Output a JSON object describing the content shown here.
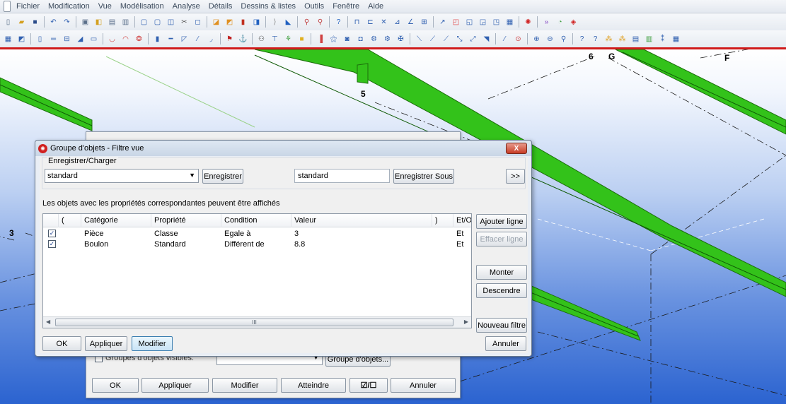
{
  "menubar": [
    "Fichier",
    "Modification",
    "Vue",
    "Modélisation",
    "Analyse",
    "Détails",
    "Dessins & listes",
    "Outils",
    "Fenêtre",
    "Aide"
  ],
  "viewport_labels": {
    "l5": "5",
    "l6": "6",
    "lG": "G",
    "lF": "F",
    "l3": "3"
  },
  "back_dialog": {
    "checkbox_label": "Groupes d'objets visibles:",
    "group_button": "Groupe d'objets...",
    "ok": "OK",
    "apply": "Appliquer",
    "modify": "Modifier",
    "reach": "Atteindre",
    "toggle": "☑/☐",
    "cancel": "Annuler"
  },
  "dialog": {
    "title": "Groupe d'objets - Filtre vue",
    "close": "X",
    "group_label": "Enregistrer/Charger",
    "load_value": "standard",
    "save_button": "Enregistrer",
    "saveas_value": "standard",
    "saveas_button": "Enregistrer Sous",
    "more_button": ">>",
    "description": "Les objets avec les propriétés correspondantes peuvent être affichés",
    "columns": {
      "open": "(",
      "category": "Catégorie",
      "property": "Propriété",
      "condition": "Condition",
      "value": "Valeur",
      "close": ")",
      "andor": "Et/Ou"
    },
    "rows": [
      {
        "checked": true,
        "category": "Pièce",
        "property": "Classe",
        "condition": "Egale à",
        "value": "3",
        "andor": "Et"
      },
      {
        "checked": true,
        "category": "Boulon",
        "property": "Standard",
        "condition": "Différent de",
        "value": "8.8",
        "andor": "Et"
      }
    ],
    "scroll_thumb": "III",
    "buttons": {
      "add": "Ajouter ligne",
      "delete": "Effacer ligne",
      "up": "Monter",
      "down": "Descendre",
      "newfilter": "Nouveau filtre",
      "ok": "OK",
      "apply": "Appliquer",
      "modify": "Modifier",
      "cancel": "Annuler"
    }
  }
}
